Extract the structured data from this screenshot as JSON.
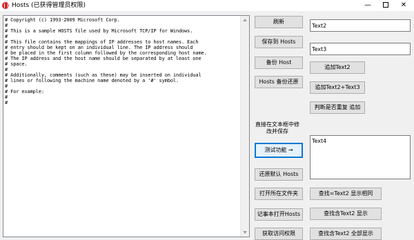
{
  "window": {
    "title": "Hosts (已获得管理员权限)",
    "controls": {
      "minimize": "—",
      "maximize": "",
      "close": "✕"
    }
  },
  "editor": {
    "content": "# Copyright (c) 1993-2009 Microsoft Corp.\n#\n# This is a sample HOSTS file used by Microsoft TCP/IP for Windows.\n#\n# This file contains the mappings of IP addresses to host names. Each\n# entry should be kept on an individual line. The IP address should\n# be placed in the first column followed by the corresponding host name.\n# The IP address and the host name should be separated by at least one\n# space.\n#\n# Additionally, comments (such as these) may be inserted on individual\n# lines or following the machine name denoted by a '#' symbol.\n#\n# For example:\n#\n#"
  },
  "buttons": {
    "refresh": "刷新",
    "save_hosts": "保存到 Hosts",
    "backup_host": "备份 Host",
    "hosts_restore": "Hosts 备份还原",
    "test_feature": "测试功能 →",
    "restore_default": "还原默认 Hosts",
    "open_folder": "打开所在文件夹",
    "notepad_open": "记事本打开Hosts",
    "get_access": "获取访问权限",
    "add_text2": "追加Text2",
    "add_text2_text3": "追加Text2+Text3",
    "check_dup_add": "判断是否重复 追加",
    "find_equal_text2": "查找=Text2 显示相同",
    "find_contains_text2": "查找含Text2 显示",
    "find_contains_text2_all": "查找含Text2 全部显示"
  },
  "hint": "直接在文本框中修改并保存",
  "fields": {
    "text2": "Text2",
    "text3": "Text3",
    "text4": "Text4"
  }
}
